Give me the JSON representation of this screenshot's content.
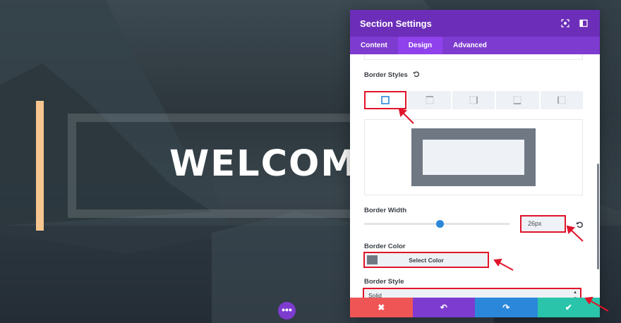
{
  "background": {
    "welcome_text": "WELCOM",
    "more_button_label": "•••",
    "accent_color": "#f7c68f"
  },
  "modal": {
    "title": "Section Settings",
    "header_icons": [
      "fullscreen-icon",
      "sidebar-toggle-icon"
    ],
    "tabs": [
      {
        "label": "Content",
        "active": false
      },
      {
        "label": "Design",
        "active": true
      },
      {
        "label": "Advanced",
        "active": false
      }
    ],
    "border_styles": {
      "label": "Border Styles",
      "options": [
        "all-sides",
        "top",
        "right",
        "bottom",
        "left"
      ],
      "selected": "all-sides"
    },
    "border_width": {
      "label": "Border Width",
      "value": "26px",
      "slider_fraction": 0.52
    },
    "border_color": {
      "label": "Border Color",
      "button_label": "Select Color",
      "swatch_color": "#6f7883"
    },
    "border_style": {
      "label": "Border Style",
      "value": "Solid"
    },
    "footer": {
      "cancel": "✖",
      "undo": "↶",
      "redo": "↷",
      "save": "✔"
    }
  },
  "colors": {
    "header_purple": "#6c2eb9",
    "tab_purple": "#7e3bd0",
    "highlight_red": "#e0142a",
    "cancel_red": "#ef5555",
    "redo_blue": "#2b87da",
    "save_green": "#29c4a9"
  }
}
